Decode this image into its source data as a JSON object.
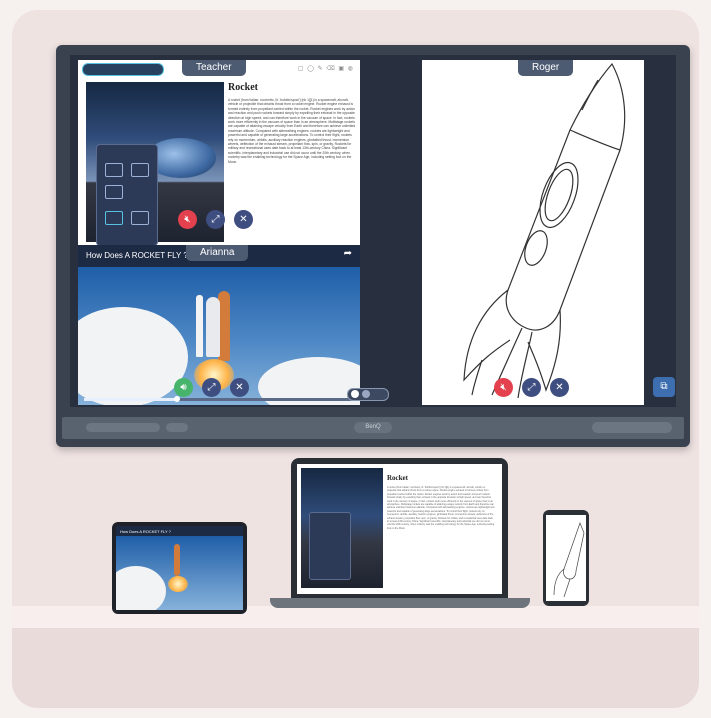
{
  "display": {
    "brand": "BenQ",
    "panels": {
      "teacher": {
        "label": "Teacher",
        "doc_title": "Rocket",
        "doc_excerpt": "A rocket (from Italian: rocchetto, lit. 'bobbin/spool') [nb 1][1] is a spacecraft, aircraft, vehicle or projectile that obtains thrust from a rocket engine. Rocket engine exhaust is formed entirely from propellant carried within the rocket. Rocket engines work by action and reaction and push rockets forward simply by expelling their exhaust in the opposite direction at high speed, and can therefore work in the vacuum of space. In fact, rockets work more efficiently in the vacuum of space than in an atmosphere. Multistage rockets are capable of attaining escape velocity from Earth and therefore can achieve unlimited maximum altitude. Compared with airbreathing engines, rockets are lightweight and powerful and capable of generating large accelerations. To control their flight, rockets rely on momentum, airfoils, auxiliary reaction engines, gimballed thrust, momentum wheels, deflection of the exhaust stream, propellant flow, spin, or gravity. Rockets for military and recreational uses date back to at least 13th-century China. Significant scientific, interplanetary and industrial use did not occur until the 20th century, when rocketry was the enabling technology for the Space Age, including setting foot on the Moon."
      },
      "arianna": {
        "label": "Arianna",
        "video_title": "How Does A ROCKET FLY ?"
      },
      "roger": {
        "label": "Roger"
      }
    }
  },
  "devices": {
    "tablet_video_title": "How Does A ROCKET FLY ?",
    "laptop_doc_title": "Rocket"
  },
  "colors": {
    "mute": "#e2414d",
    "unmute": "#46b46b",
    "control": "#3e4e80",
    "label_bg": "#4c5a72"
  },
  "icons": {
    "mute": "speaker-muted-icon",
    "unmute": "speaker-icon",
    "fullscreen": "fullscreen-icon",
    "close": "close-icon",
    "share": "share-icon",
    "cast": "screen-cast-icon"
  }
}
